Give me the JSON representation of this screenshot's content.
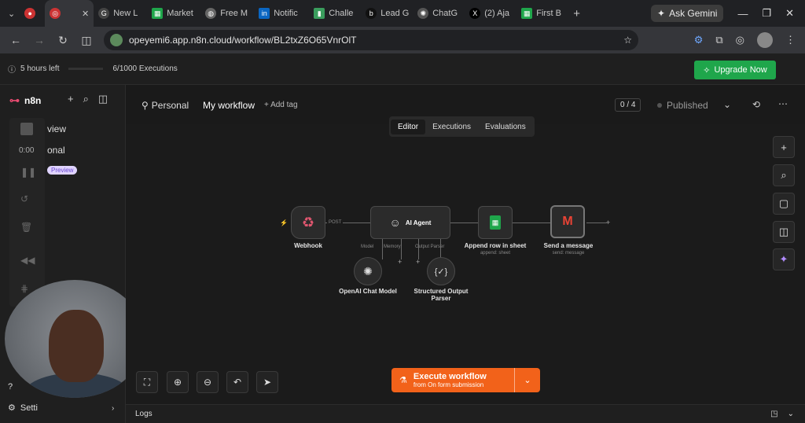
{
  "browser": {
    "tabs": [
      {
        "label": "",
        "icon": "record-icon"
      },
      {
        "label": "",
        "icon": "n8n-icon",
        "active": true
      },
      {
        "label": "New L",
        "icon": "gemini-icon"
      },
      {
        "label": "Market",
        "icon": "sheets-icon"
      },
      {
        "label": "Free M",
        "icon": "globe-icon"
      },
      {
        "label": "Notific",
        "icon": "linkedin-icon"
      },
      {
        "label": "Challe",
        "icon": "bookmark-icon"
      },
      {
        "label": "Lead G",
        "icon": "b-icon"
      },
      {
        "label": "ChatG",
        "icon": "chatgpt-icon"
      },
      {
        "label": "(2) Aja",
        "icon": "x-icon"
      },
      {
        "label": "First B",
        "icon": "sheets-icon"
      }
    ],
    "ask_gemini": "Ask Gemini",
    "url": "opeyemi6.app.n8n.cloud/workflow/BL2txZ6O65VnrOlT"
  },
  "banner": {
    "trial_left": "5 hours left",
    "executions": "6/1000 Executions",
    "upgrade_label": "Upgrade Now"
  },
  "sidebar": {
    "logo": "n8n",
    "item1": "view",
    "item2": "onal",
    "badge": "Preview",
    "timer": "0:00",
    "settings": "Setti"
  },
  "header": {
    "project": "Personal",
    "workflow_name": "My workflow",
    "add_tag": "+ Add tag",
    "counter": "0 / 4",
    "status": "Published"
  },
  "modes": [
    "Editor",
    "Executions",
    "Evaluations"
  ],
  "nodes": {
    "webhook": "Webhook",
    "webhook_port": "POST",
    "agent": "AI Agent",
    "agent_port1": "Model",
    "agent_port2": "Memory",
    "agent_port3": "Output Parser",
    "sheet": "Append row in sheet",
    "sheet_sub": "append: sheet",
    "gmail": "Send a message",
    "gmail_sub": "send: message",
    "openai": "OpenAI Chat Model",
    "parser": "Structured Output Parser"
  },
  "execute": {
    "label": "Execute workflow",
    "sub": "from On form submission"
  },
  "logs_label": "Logs",
  "colors": {
    "accent": "#f2621a",
    "upgrade": "#1fa64b",
    "badge": "#e0d4ff"
  }
}
